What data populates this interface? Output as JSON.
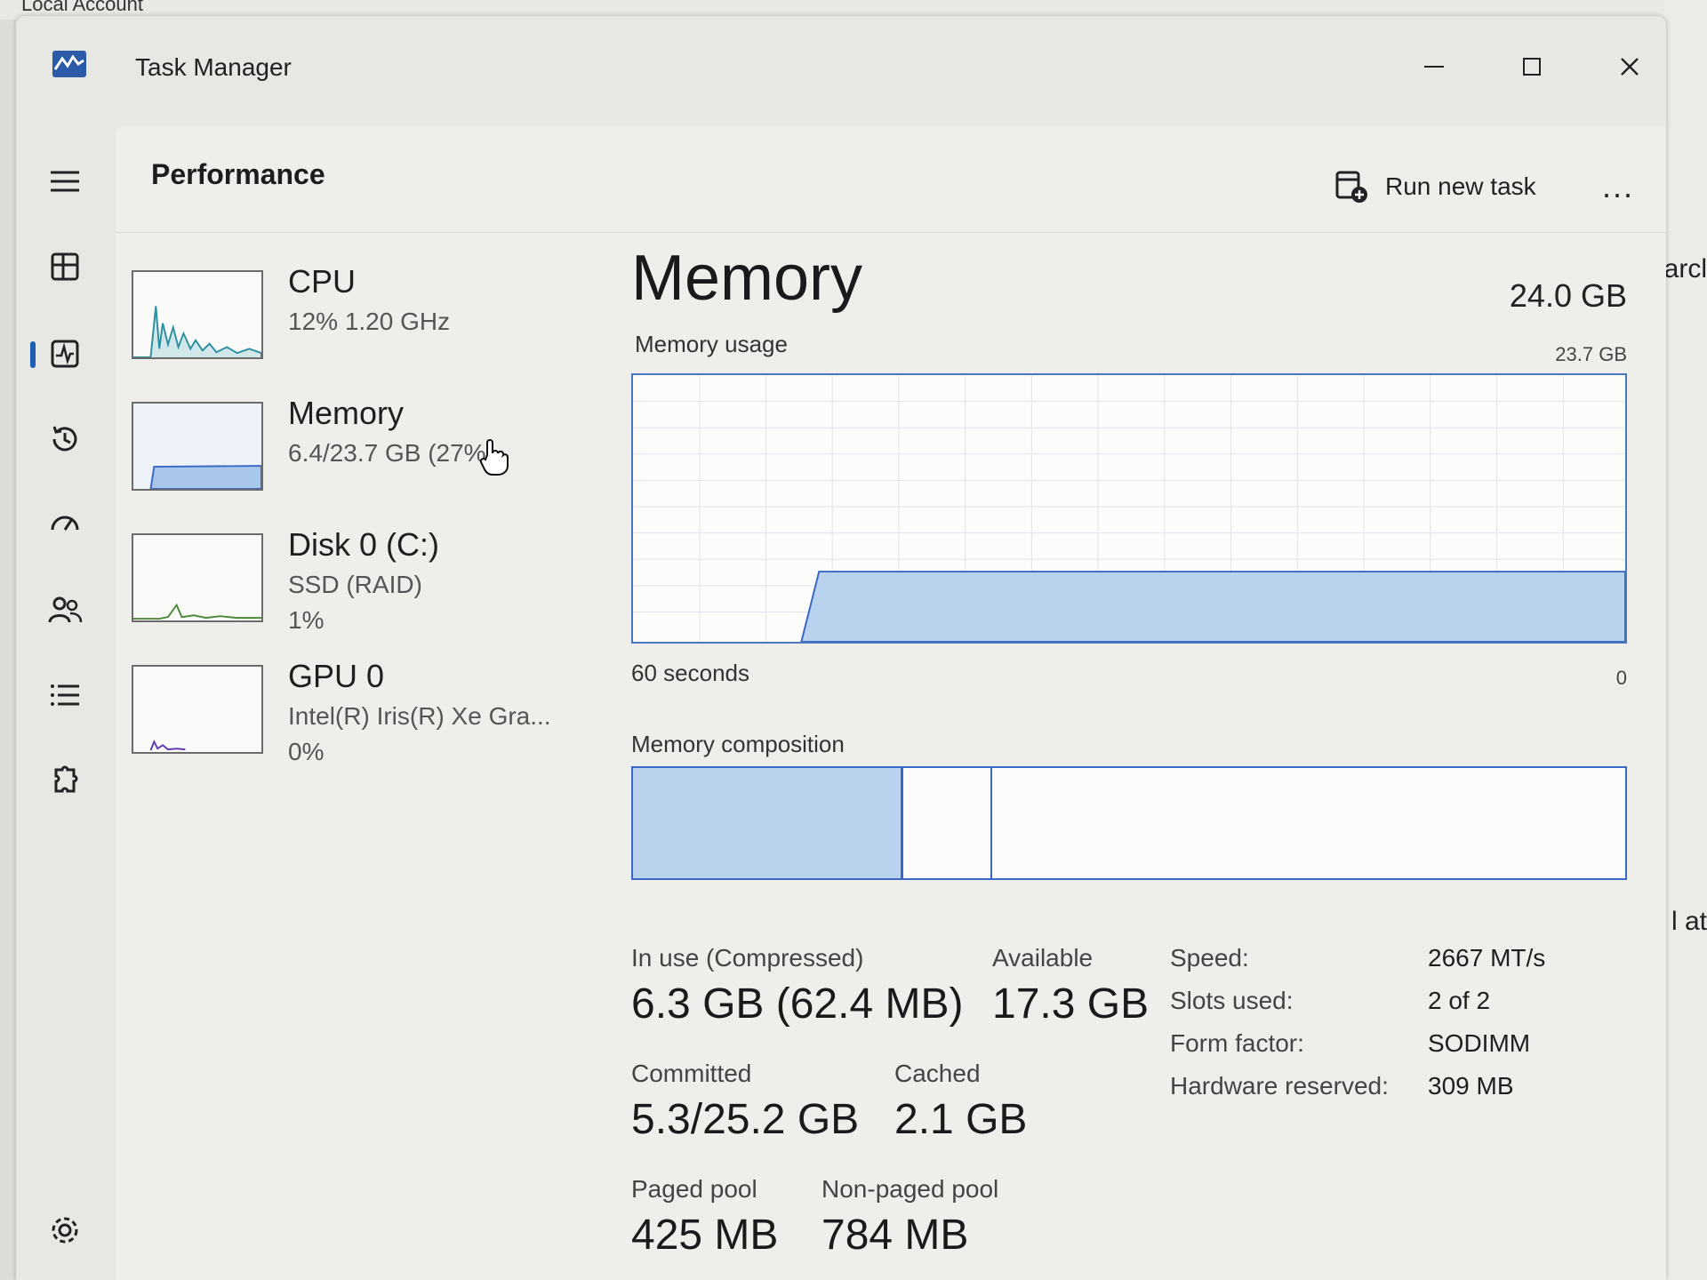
{
  "background": {
    "top_text": "Local Account",
    "right_text_1": "arcl",
    "right_text_2": "l at"
  },
  "window": {
    "title": "Task Manager"
  },
  "header": {
    "page_title": "Performance",
    "run_new_task": "Run new task",
    "more": "..."
  },
  "perf_list": [
    {
      "name": "CPU",
      "sub": "12%  1.20 GHz",
      "sub2": ""
    },
    {
      "name": "Memory",
      "sub": "6.4/23.7 GB (27%)",
      "sub2": ""
    },
    {
      "name": "Disk 0 (C:)",
      "sub": "SSD (RAID)",
      "sub2": "1%"
    },
    {
      "name": "GPU 0",
      "sub": "Intel(R) Iris(R) Xe Gra...",
      "sub2": "0%"
    }
  ],
  "main": {
    "title": "Memory",
    "total": "24.0 GB",
    "usage_label": "Memory usage",
    "usage_max": "23.7 GB",
    "time_span": "60 seconds",
    "zero": "0",
    "composition_label": "Memory composition",
    "stats": {
      "in_use_label": "In use (Compressed)",
      "in_use_value": "6.3 GB (62.4 MB)",
      "available_label": "Available",
      "available_value": "17.3 GB",
      "committed_label": "Committed",
      "committed_value": "5.3/25.2 GB",
      "cached_label": "Cached",
      "cached_value": "2.1 GB",
      "paged_label": "Paged pool",
      "paged_value": "425 MB",
      "nonpaged_label": "Non-paged pool",
      "nonpaged_value": "784 MB"
    },
    "specs": [
      {
        "key": "Speed:",
        "value": "2667 MT/s"
      },
      {
        "key": "Slots used:",
        "value": "2 of 2"
      },
      {
        "key": "Form factor:",
        "value": "SODIMM"
      },
      {
        "key": "Hardware reserved:",
        "value": "309 MB"
      }
    ]
  },
  "colors": {
    "accent": "#1a5fb4",
    "chart_line": "#4a78c0",
    "chart_fill": "#b9d3ee"
  }
}
